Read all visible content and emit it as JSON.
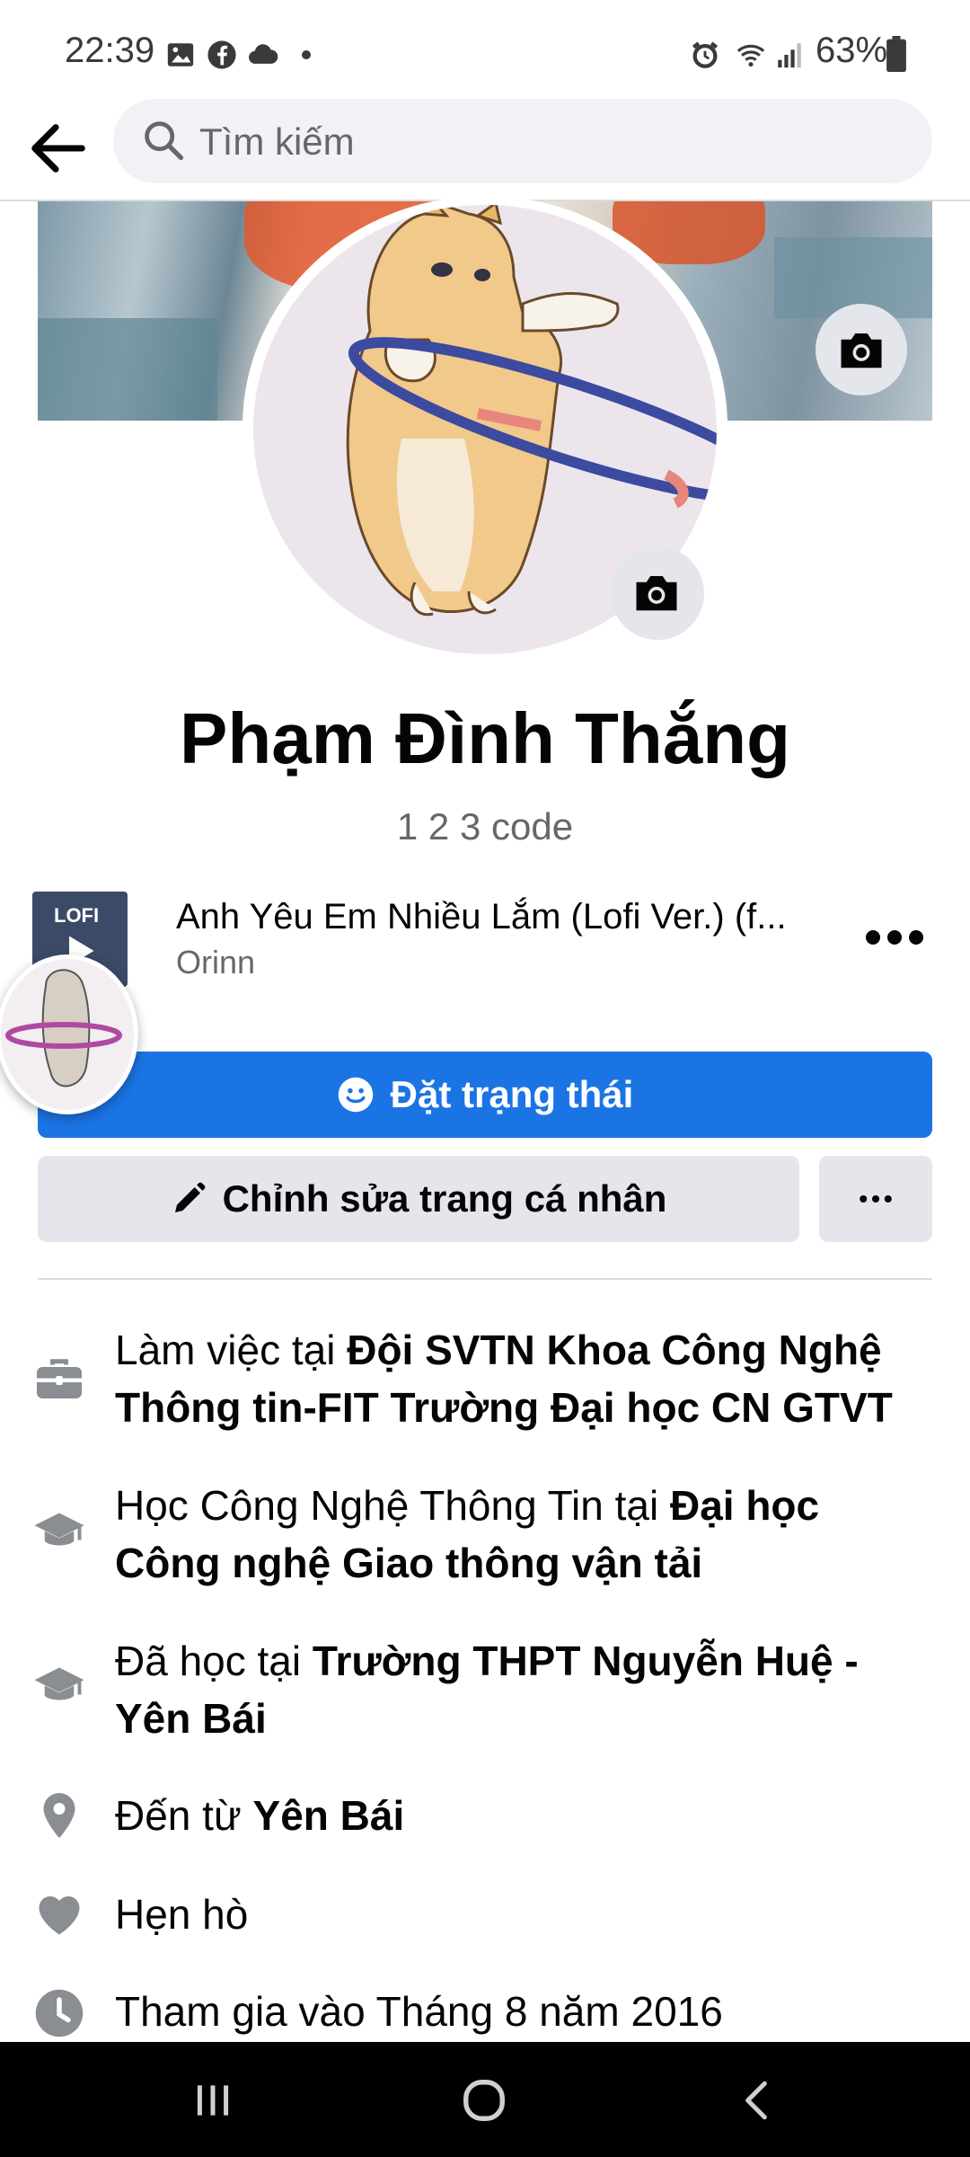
{
  "status_bar": {
    "time": "22:39",
    "battery": "63%",
    "left_icons": [
      "gallery-icon",
      "facebook-icon",
      "cloud-icon",
      "dot-icon"
    ],
    "right_icons": [
      "alarm-icon",
      "wifi-icon",
      "signal-icon",
      "battery-icon"
    ]
  },
  "header": {
    "search_placeholder": "Tìm kiếm"
  },
  "profile": {
    "name": "Phạm Đình Thắng",
    "bio": "1 2 3 code"
  },
  "music": {
    "thumb_label": "LOFI",
    "title": "Anh Yêu Em Nhiều Lắm (Lofi Ver.) (f...",
    "artist": "Orinn"
  },
  "buttons": {
    "status": "Đặt trạng thái",
    "edit_profile": "Chỉnh sửa trang cá nhân"
  },
  "details": [
    {
      "icon": "briefcase-icon",
      "prefix": "Làm việc tại ",
      "bold": "Đội SVTN Khoa Công Nghệ Thông tin-FIT Trường Đại học CN GTVT"
    },
    {
      "icon": "graduation-cap-icon",
      "prefix": "Học Công Nghệ Thông Tin tại ",
      "bold": "Đại học Công nghệ Giao thông vận tải"
    },
    {
      "icon": "graduation-cap-icon",
      "prefix": "Đã học tại ",
      "bold": "Trường THPT Nguyễn Huệ - Yên Bái"
    },
    {
      "icon": "location-pin-icon",
      "prefix": "Đến từ ",
      "bold": "Yên Bái"
    },
    {
      "icon": "heart-icon",
      "prefix": "Hẹn hò",
      "bold": ""
    },
    {
      "icon": "clock-icon",
      "prefix": "Tham gia vào Tháng 8 năm 2016",
      "bold": ""
    }
  ],
  "colors": {
    "accent": "#1b74e4",
    "secondary_button": "#e4e6eb",
    "secondary_text": "#65676b"
  }
}
